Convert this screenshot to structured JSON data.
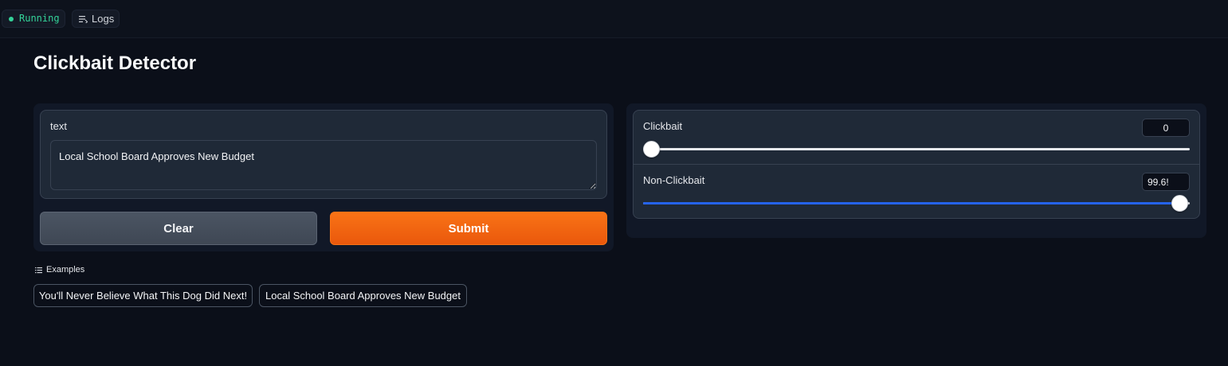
{
  "status": {
    "running_label": "Running",
    "logs_label": "Logs"
  },
  "page": {
    "title": "Clickbait Detector"
  },
  "input": {
    "label": "text",
    "value": "Local School Board Approves New Budget"
  },
  "buttons": {
    "clear_label": "Clear",
    "submit_label": "Submit"
  },
  "examples": {
    "label": "Examples",
    "items": [
      "You'll Never Believe What This Dog Did Next!",
      "Local School Board Approves New Budget"
    ]
  },
  "output": {
    "sliders": [
      {
        "label": "Clickbait",
        "value_display": "0",
        "value": 0,
        "min": 0,
        "max": 100
      },
      {
        "label": "Non-Clickbait",
        "value_display": "99.6!",
        "value": 99.65,
        "min": 0,
        "max": 100
      }
    ]
  },
  "colors": {
    "accent": "#f97316",
    "slider_fill": "#2563eb",
    "running": "#34d399",
    "background": "#0b0f19"
  }
}
